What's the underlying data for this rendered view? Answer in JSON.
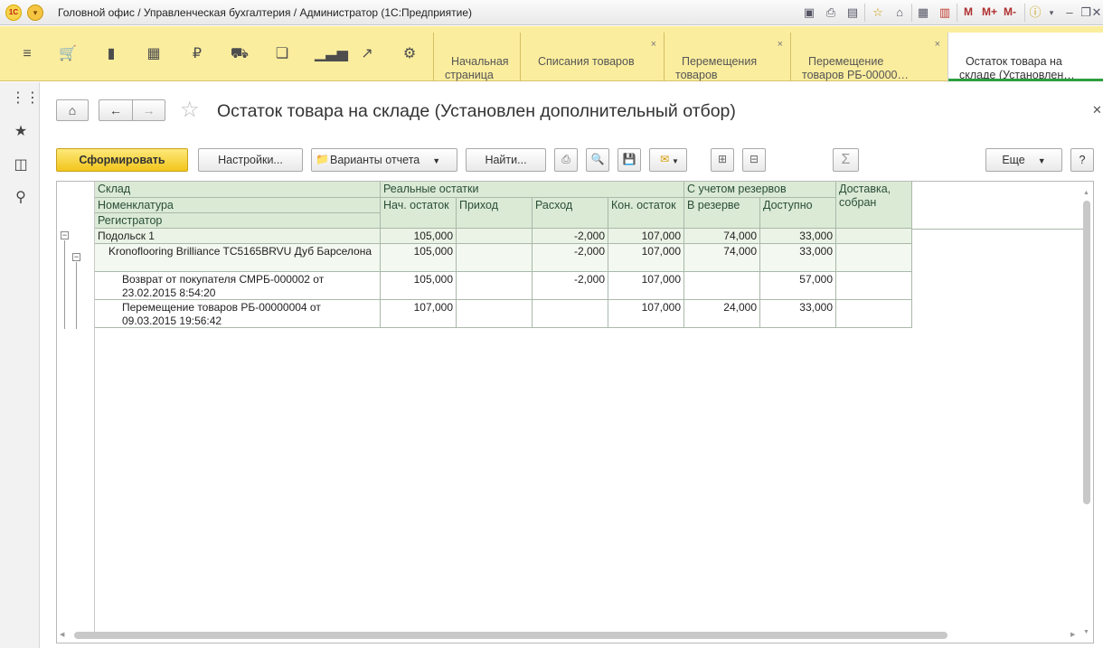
{
  "window": {
    "title": "Головной офис / Управленческая бухгалтерия / Администратор  (1С:Предприятие)",
    "logo_text": "1С",
    "m_buttons": [
      "M",
      "M+",
      "M-"
    ]
  },
  "sections": {
    "icons": [
      "menu-icon",
      "cart-icon",
      "bag-icon",
      "grid-icon",
      "ruble-icon",
      "truck-icon",
      "documents-icon",
      "bar-chart-icon",
      "trend-icon",
      "gear-icon"
    ]
  },
  "open_tabs": [
    {
      "label": "Начальная\nстраница",
      "closable": false,
      "active": false
    },
    {
      "label": "Списания товаров",
      "closable": true,
      "active": false
    },
    {
      "label": "Перемещения\nтоваров",
      "closable": true,
      "active": false
    },
    {
      "label": "Перемещение\nтоваров РБ-00000…",
      "closable": true,
      "active": false
    },
    {
      "label": "Остаток товара на\nскладе (Установлен…",
      "closable": false,
      "active": true
    }
  ],
  "form": {
    "title": "Остаток товара на складе (Установлен дополнительный отбор)"
  },
  "toolbar": {
    "generate": "Сформировать",
    "settings": "Настройки...",
    "variants": "Варианты отчета",
    "find": "Найти...",
    "more": "Еще",
    "help": "?",
    "sum": "Σ"
  },
  "report": {
    "headers": {
      "warehouse": "Склад",
      "item": "Номенклатура",
      "registrar": "Регистратор",
      "real": "Реальные остатки",
      "reserve_group": "С учетом резервов",
      "delivery": "Доставка,\nсобран",
      "start": "Нач. остаток",
      "income": "Приход",
      "expense": "Расход",
      "end": "Кон. остаток",
      "reserved": "В резерве",
      "available": "Доступно"
    },
    "rows": [
      {
        "label": "Подольск 1",
        "start": "105,000",
        "income": "",
        "expense": "-2,000",
        "end": "107,000",
        "reserved": "74,000",
        "available": "33,000",
        "delivery": ""
      },
      {
        "label": "Kronoflooring Brilliance TC5165BRVU Дуб Барселона",
        "start": "105,000",
        "income": "",
        "expense": "-2,000",
        "end": "107,000",
        "reserved": "74,000",
        "available": "33,000",
        "delivery": ""
      },
      {
        "label": "Возврат от покупателя СМРБ-000002 от 23.02.2015 8:54:20",
        "start": "105,000",
        "income": "",
        "expense": "-2,000",
        "end": "107,000",
        "reserved": "",
        "available": "57,000",
        "delivery": ""
      },
      {
        "label": "Перемещение товаров РБ-00000004 от 09.03.2015 19:56:42",
        "start": "107,000",
        "income": "",
        "expense": "",
        "end": "107,000",
        "reserved": "24,000",
        "available": "33,000",
        "delivery": ""
      }
    ]
  }
}
